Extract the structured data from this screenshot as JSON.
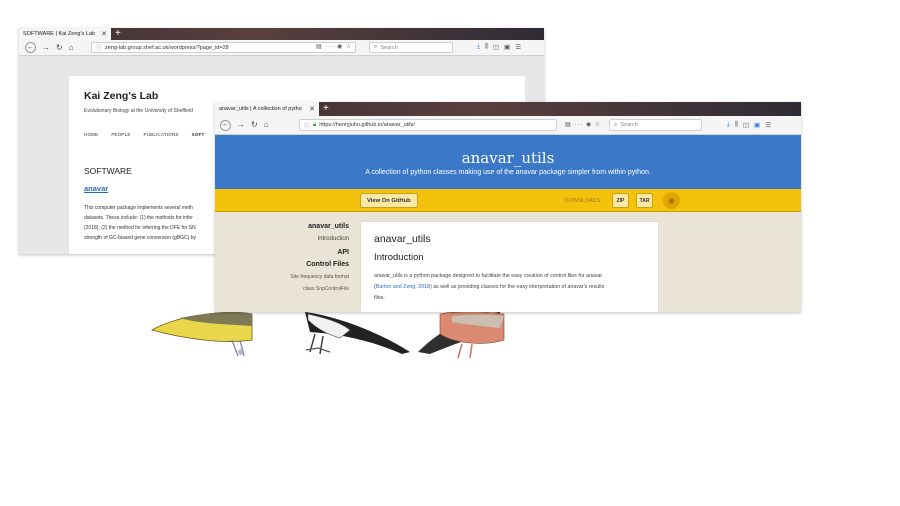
{
  "back_browser": {
    "tab_title": "SOFTWARE | Kai Zeng's Lab",
    "url": "zeng-lab.group.shef.ac.uk/wordpress/?page_id=28",
    "search_placeholder": "Search",
    "site_title": "Kai Zeng's Lab",
    "site_subtitle": "Evolutionary Biology at the University of Sheffield",
    "nav_items": [
      "HOME",
      "PEOPLE",
      "PUBLICATIONS",
      "SOFT"
    ],
    "section_title": "SOFTWARE",
    "section_link": "anavar",
    "body_lines": [
      "This computer package implements several meth",
      "datasets. These include: (1) the methods for infer",
      "(2018), (2) the method for inferring the DFE for SN",
      "strength of GC-biased gene conversion (gBGC) by"
    ]
  },
  "front_browser": {
    "tab_title": "anavar_utils | A collection of pytho",
    "url": "https://henryjuho.github.io/anavar_utils/",
    "search_placeholder": "Search",
    "hero_title": "anavar_utils",
    "hero_subtitle": "A collection of python classes making use of the anavar package simpler from within python.",
    "github_button": "View On GitHub",
    "downloads_label": "DOWNLOADS",
    "zip_label": "ZIP",
    "tar_label": "TAR",
    "sidebar": {
      "title": "anavar_utils",
      "intro": "Introduction",
      "api": "API",
      "control_files": "Control Files",
      "sfs_format": "Site frequency data format",
      "class_snp": "class SnpControlFile"
    },
    "article": {
      "h1": "anavar_utils",
      "h2": "Introduction",
      "p1": "anavar_utils is a python package designed to facilitate the easy creation of control files for anavar",
      "p2_cite": "Barton and Zeng, 2018",
      "p2_pre": "(",
      "p2_post": ") as well as providing classes for the easy interpretation of anavar's results",
      "p3": "files."
    }
  },
  "colors": {
    "hero_blue": "#3b78c7",
    "bar_yellow": "#f4c20d",
    "link_blue": "#1f6fb5"
  }
}
